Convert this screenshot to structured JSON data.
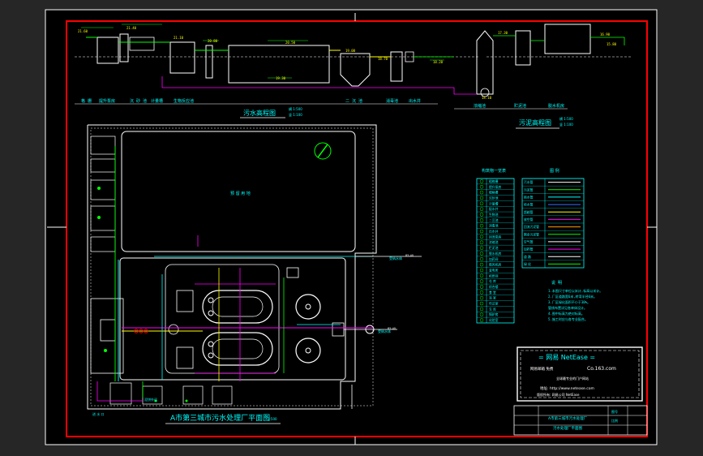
{
  "drawing": {
    "colors": {
      "background": "#000000",
      "outer_bg": "#262626",
      "frame_outer": "#ffffff",
      "frame_red": "#ff0000",
      "line_white": "#ffffff",
      "line_green": "#00ff00",
      "line_yellow": "#ffff00",
      "line_magenta": "#ff00ff",
      "line_cyan": "#00ffff",
      "line_blue": "#3b6cff",
      "line_orange": "#ff9900"
    },
    "titles": {
      "sewage_profile": "污水高程图",
      "sludge_profile": "污泥高程图",
      "plan": "A市第三城市污水处理厂平面图",
      "plan_scale": "1:500"
    },
    "scale_notes": {
      "sewage_h": "横 1:500",
      "sewage_v": "竖 1:100",
      "sludge_h": "横 1:500",
      "sludge_v": "竖 1:100"
    },
    "profile_values": [
      "21.60",
      "21.40",
      "21.10",
      "20.80",
      "20.50",
      "19.30",
      "19.00",
      "18.70",
      "18.20",
      "17.30",
      "16.90",
      "15.80",
      "14.10"
    ],
    "profile_labels": [
      "格 栅",
      "提升泵房",
      "沉 砂 池",
      "计量槽",
      "生物反应池",
      "二 沉 池",
      "消毒池",
      "出水井"
    ],
    "sludge_labels": [
      "浓缩池",
      "贮泥池",
      "脱水机房"
    ],
    "plan_labels": {
      "reserve": "预 留 用 地",
      "river1": "受纳水体",
      "river2": "受纳水体",
      "gate_note": "进 水 口",
      "sludge_out": "泥饼外运"
    },
    "legend_table": {
      "title": "构筑物一览表",
      "rows": [
        "粗格栅",
        "提升泵房",
        "细格栅",
        "沉砂池",
        "计量槽",
        "配水井",
        "生物池",
        "二沉池",
        "消毒池",
        "出水井",
        "回流泵房",
        "浓缩池",
        "贮泥池",
        "脱水机房",
        "加药间",
        "鼓风机房",
        "变电所",
        "机修间",
        "仓 库",
        "综合楼",
        "食 堂",
        "浴 室",
        "传达室",
        "车 库",
        "锅炉房",
        "化验室"
      ]
    },
    "symbols_table": {
      "title": "图 例",
      "rows": [
        {
          "name": "污水管",
          "color": "#ffffff"
        },
        {
          "name": "污泥管",
          "color": "#00ff00"
        },
        {
          "name": "雨水管",
          "color": "#00ffff"
        },
        {
          "name": "给水管",
          "color": "#3b6cff"
        },
        {
          "name": "超越管",
          "color": "#ffff00"
        },
        {
          "name": "放空管",
          "color": "#ff00ff"
        },
        {
          "name": "回流污泥管",
          "color": "#ff9900"
        },
        {
          "name": "剩余污泥管",
          "color": "#00ff00"
        },
        {
          "name": "空气管",
          "color": "#ffffff"
        },
        {
          "name": "加药管",
          "color": "#ff00ff"
        },
        {
          "name": "道 路",
          "color": "#ffffff"
        },
        {
          "name": "绿 化",
          "color": "#00ff00"
        }
      ]
    },
    "notes": {
      "title": "说 明",
      "lines": [
        "1.本图尺寸单位以米计,标高以米计。",
        "2.厂区道路宽6米,转弯半径6米。",
        "3.厂区绿化面积不小于30%。",
        "   管线布置详见各单体设计。",
        "4.图中标高为绝对标高。",
        "5.施工时应与各专业配合。"
      ]
    },
    "stamp": {
      "line1": "= 网易 NetEase =",
      "line2_left": "网易邮箱 免费",
      "line2_right": "Co.163.com",
      "line3": "全球最专业的门户网站",
      "line4": "地址: http://www.netease.com",
      "line5": "版权所有: 网易公司 NetEase"
    },
    "title_block": {
      "r1c2": "A市第三城市污水处理厂",
      "r2c2": "污水处理厂平面图",
      "r1c3": "图号",
      "r2c3": "比例"
    },
    "coord_labels": [
      "85.40",
      "85.40",
      "85.40",
      "85.40"
    ]
  }
}
